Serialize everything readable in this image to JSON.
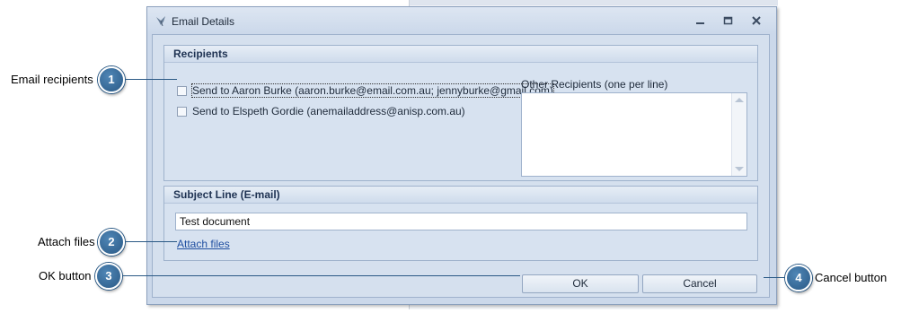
{
  "dialog": {
    "title": "Email Details",
    "icon": "email-bird-icon"
  },
  "recipients": {
    "header": "Recipients",
    "items": [
      {
        "label": "Send to Aaron Burke (aaron.burke@email.com.au; jennyburke@gmail.com)",
        "checked": false
      },
      {
        "label": "Send to Elspeth Gordie (anemailaddress@anisp.com.au)",
        "checked": false
      }
    ],
    "other_label": "Other Recipients (one per line)",
    "other_value": ""
  },
  "subject": {
    "header": "Subject Line (E-mail)",
    "value": "Test document",
    "attach_label": "Attach files"
  },
  "buttons": {
    "ok": "OK",
    "cancel": "Cancel"
  },
  "callouts": [
    {
      "number": "1",
      "label": "Email recipients"
    },
    {
      "number": "2",
      "label": "Attach files"
    },
    {
      "number": "3",
      "label": "OK button"
    },
    {
      "number": "4",
      "label": "Cancel button"
    }
  ],
  "colors": {
    "dialog_bg": "#cbd8ea",
    "callout_badge": "#2a5985",
    "link": "#1f4ea0"
  }
}
